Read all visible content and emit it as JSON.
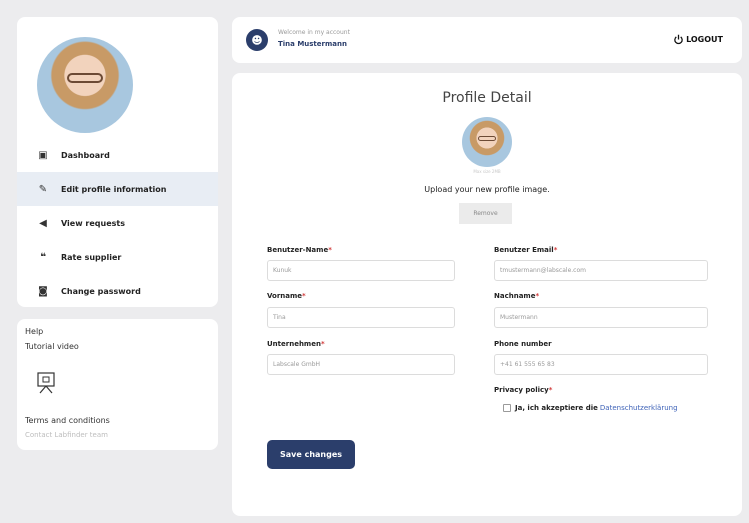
{
  "header": {
    "welcome_text": "Welcome in my account",
    "user_name": "Tina Mustermann",
    "logout_label": "LOGOUT"
  },
  "sidebar": {
    "items": [
      {
        "label": "Dashboard",
        "icon": "dashboard-icon",
        "active": false
      },
      {
        "label": "Edit profile information",
        "icon": "edit-profile-icon",
        "active": true
      },
      {
        "label": "View requests",
        "icon": "megaphone-icon",
        "active": false
      },
      {
        "label": "Rate supplier",
        "icon": "rate-icon",
        "active": false
      },
      {
        "label": "Change password",
        "icon": "lock-icon",
        "active": false
      }
    ]
  },
  "help": {
    "title": "Help",
    "tutorial_label": "Tutorial video",
    "terms_label": "Terms and conditions",
    "contact_label": "Contact Labfinder team"
  },
  "profile": {
    "title": "Profile Detail",
    "avatar_caption": "Max size 2MB",
    "upload_label": "Upload your new profile image.",
    "remove_label": "Remove",
    "fields": {
      "username": {
        "label": "Benutzer-Name",
        "value": "Kunuk",
        "required": true
      },
      "email": {
        "label": "Benutzer Email",
        "value": "tmustermann@labscale.com",
        "required": true
      },
      "firstname": {
        "label": "Vorname",
        "value": "Tina",
        "required": true
      },
      "lastname": {
        "label": "Nachname",
        "value": "Mustermann",
        "required": true
      },
      "company": {
        "label": "Unternehmen",
        "value": "Labscale GmbH",
        "required": true
      },
      "phone": {
        "label": "Phone number",
        "value": "+41 61 555 65 83",
        "required": false
      }
    },
    "privacy": {
      "label": "Privacy policy",
      "consent_text": "Ja, ich akzeptiere die",
      "link_text": "Datenschutzerklärung"
    },
    "save_label": "Save changes"
  },
  "colors": {
    "primary": "#2b3e6b",
    "active_nav_bg": "#e8edf4",
    "required_mark": "#d23a3a",
    "link": "#3f63b8",
    "page_bg": "#ececee"
  }
}
